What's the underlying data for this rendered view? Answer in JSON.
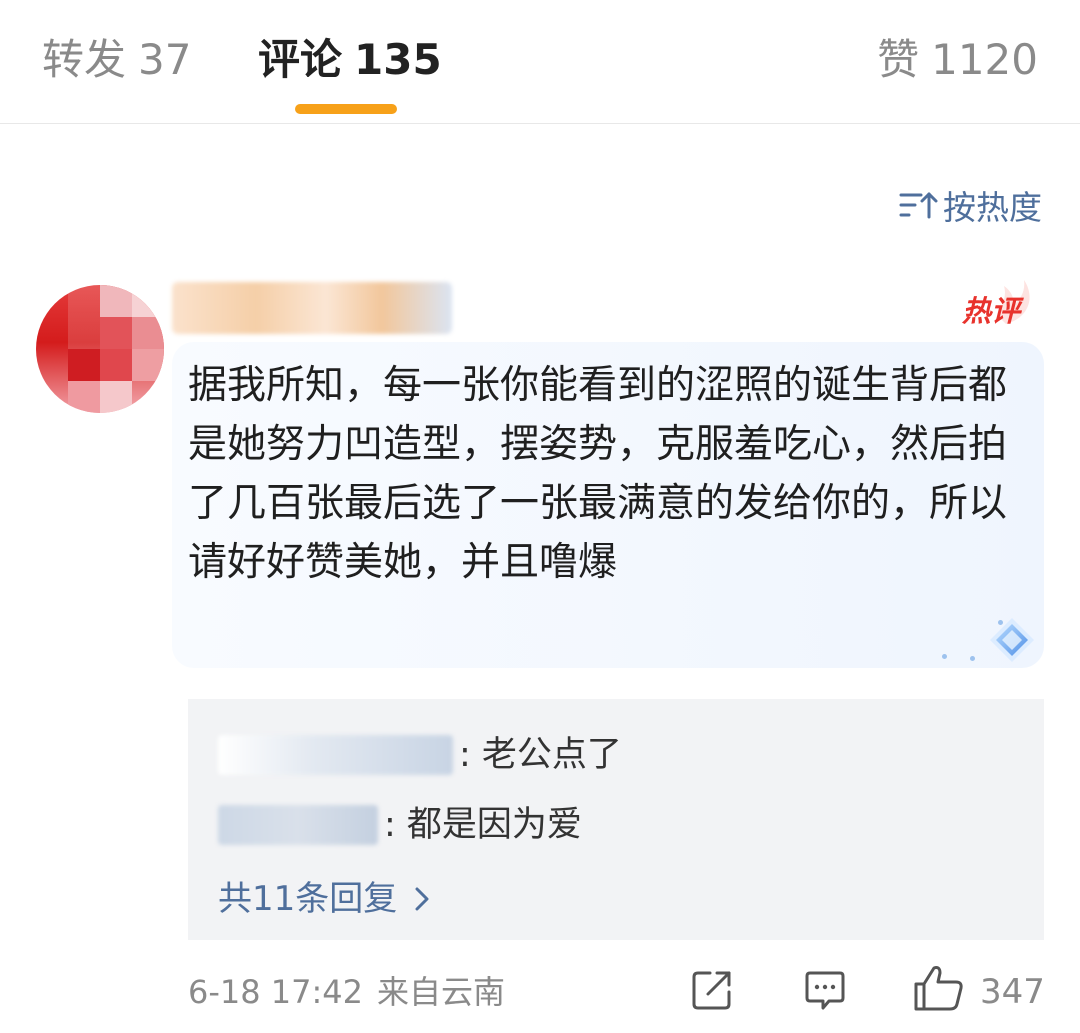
{
  "tabs": {
    "reposts": {
      "label": "转发",
      "count": "37"
    },
    "comments": {
      "label": "评论",
      "count": "135",
      "active": true
    },
    "likes": {
      "label": "赞",
      "count": "1120"
    },
    "accent_color": "#f7a119"
  },
  "sort": {
    "label": "按热度",
    "icon": "sort-icon"
  },
  "comment": {
    "badge": "热评",
    "text": "据我所知，每一张你能看到的涩照的诞生背后都是她努力凹造型，摆姿势，克服羞吃心，然后拍了几百张最后选了一张最满意的发给你的，所以请好好赞美她，并且噜爆",
    "time": "6-18 17:42",
    "source": "来自云南",
    "like_count": "347",
    "replies": [
      {
        "text": ": 老公点了"
      },
      {
        "text": ": 都是因为爱"
      }
    ],
    "more_replies": "共11条回复",
    "colors": {
      "link": "#4f6f9c",
      "hot_badge": "#e8322c",
      "bubble": "#eff5fe",
      "reply_bg": "#f2f3f5"
    }
  }
}
